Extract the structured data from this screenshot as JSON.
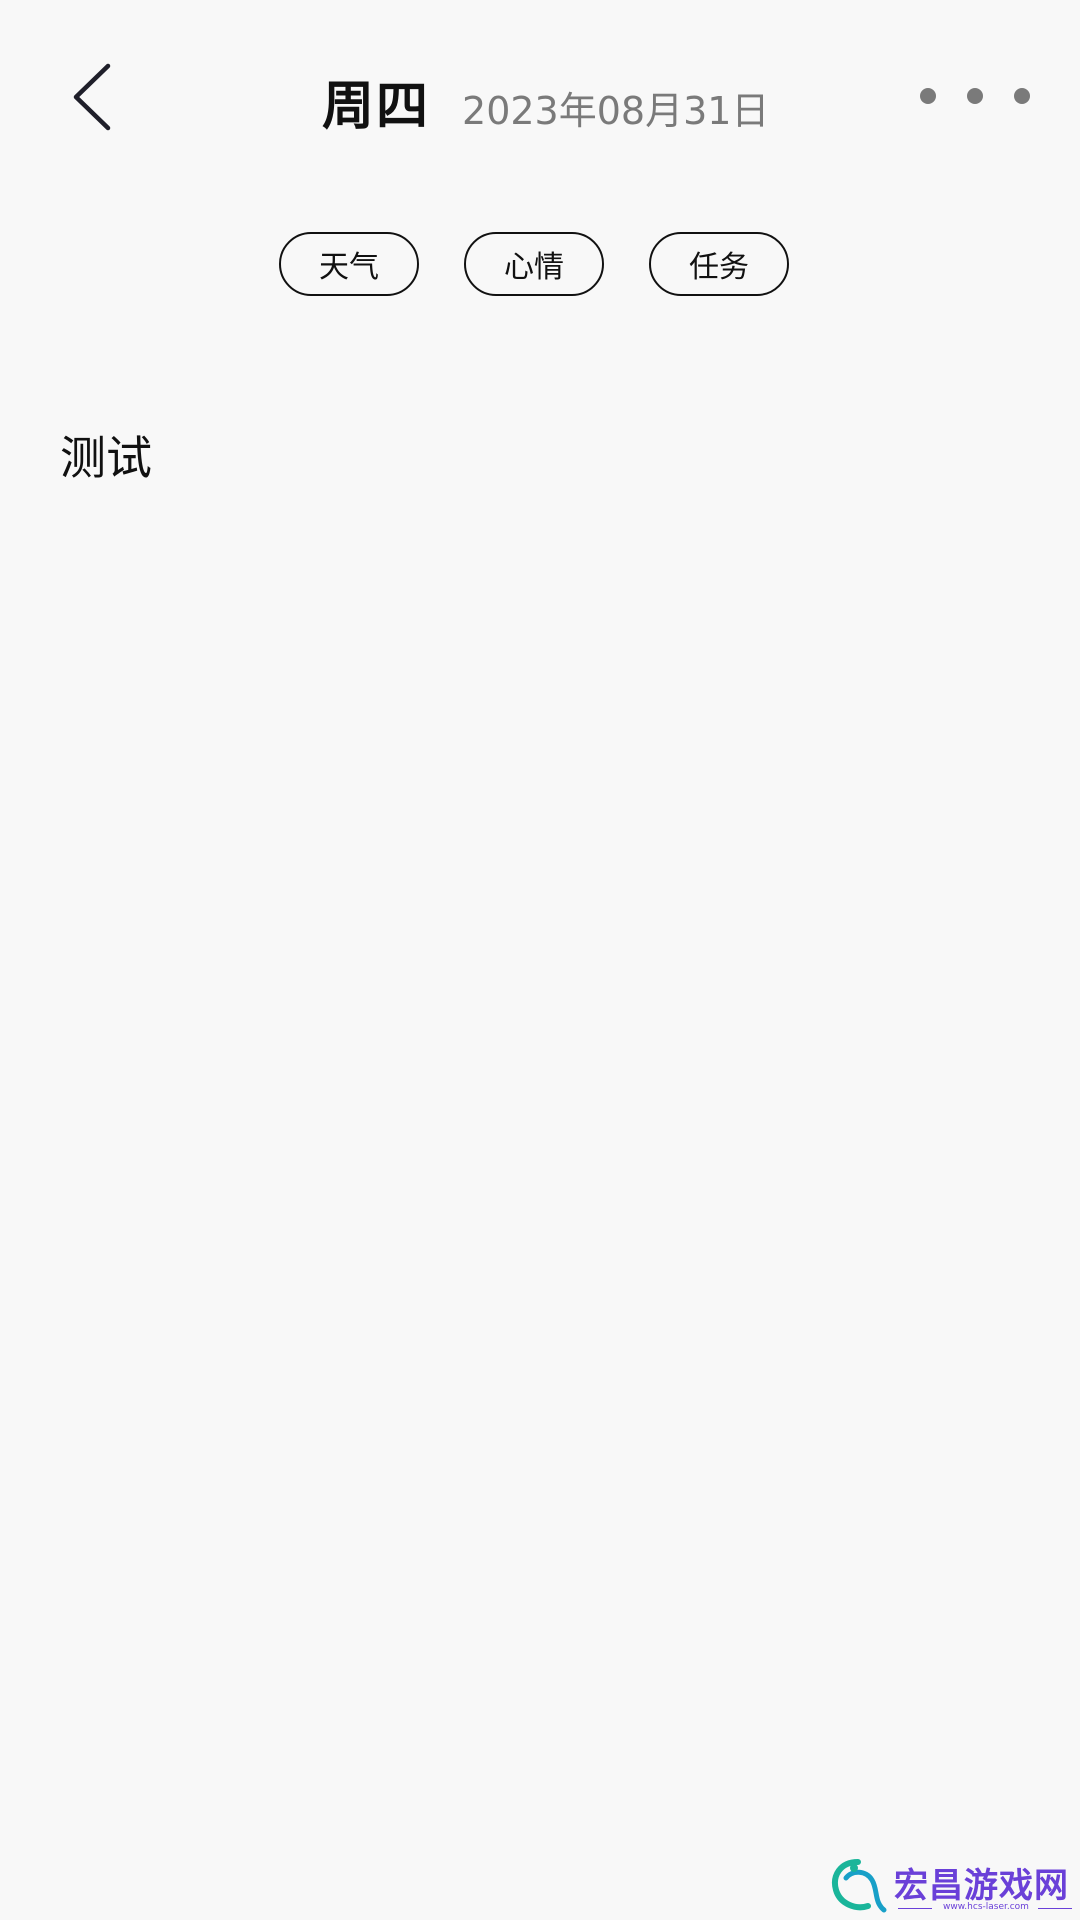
{
  "header": {
    "weekday": "周四",
    "date": "2023年08月31日"
  },
  "tags": [
    {
      "label": "天气"
    },
    {
      "label": "心情"
    },
    {
      "label": "任务"
    }
  ],
  "content": {
    "text": "测试"
  },
  "icons": {
    "back": "chevron-left-icon",
    "more": "more-horizontal-icon"
  },
  "watermark": {
    "text": "宏昌游戏网",
    "url": "www.hcs-laser.com",
    "color": "#6a40d8"
  }
}
